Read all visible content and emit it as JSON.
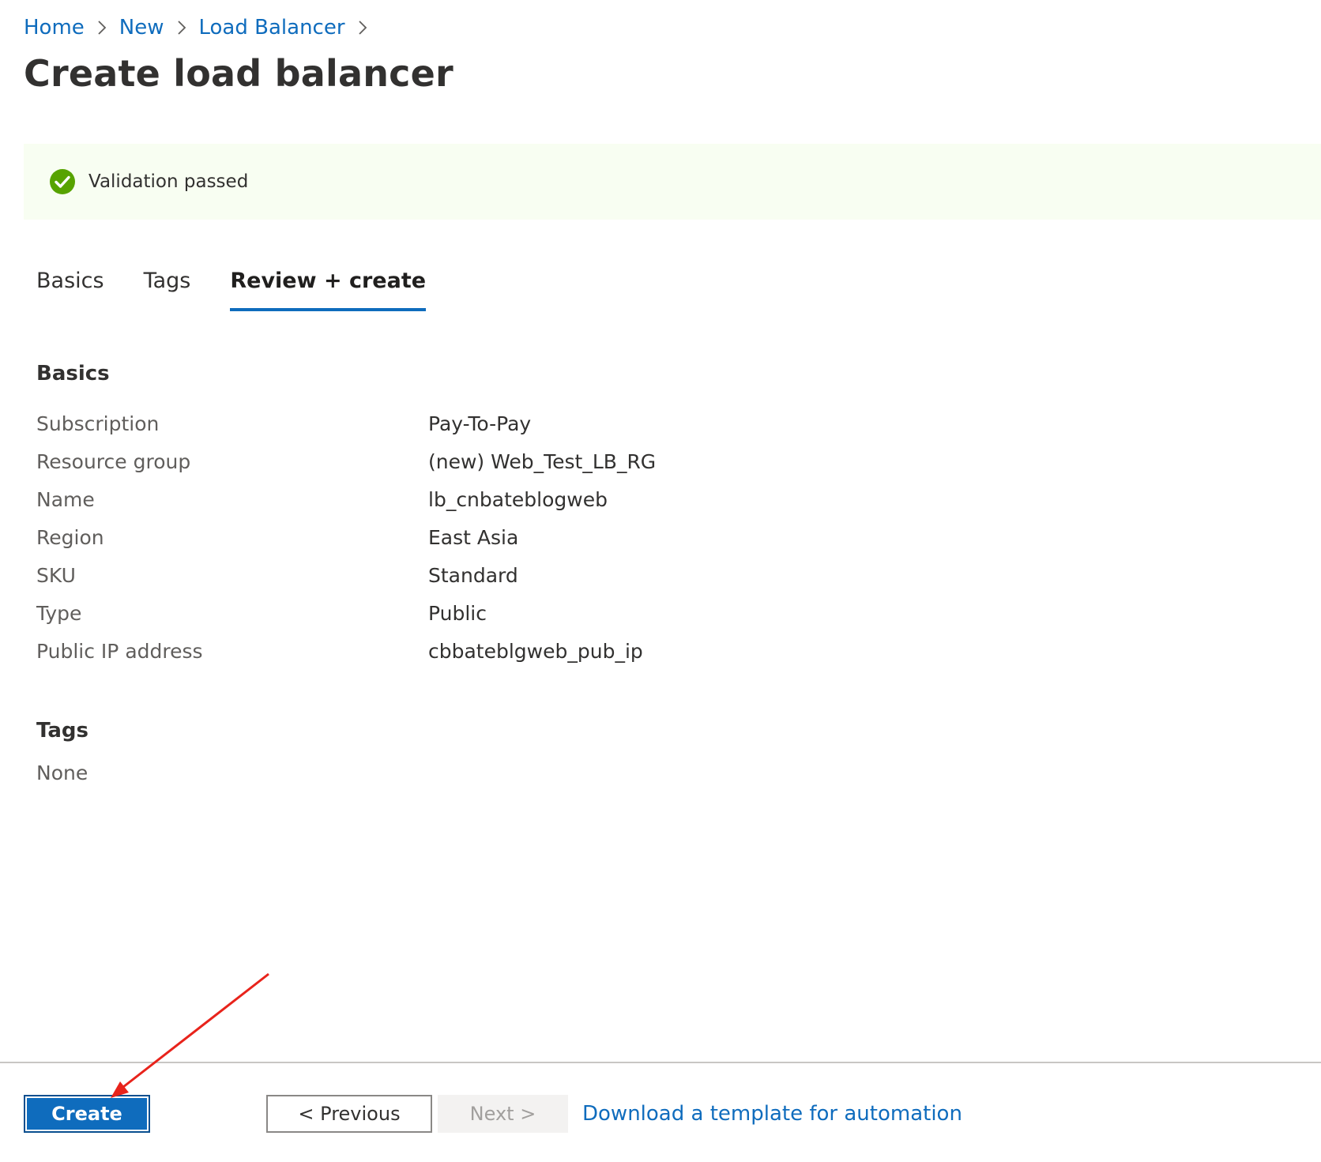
{
  "breadcrumb": {
    "items": [
      "Home",
      "New",
      "Load Balancer"
    ]
  },
  "page": {
    "title": "Create load balancer"
  },
  "banner": {
    "text": "Validation passed",
    "icon": "check-circle-icon",
    "color": "#57a300"
  },
  "tabs": [
    {
      "label": "Basics",
      "active": false
    },
    {
      "label": "Tags",
      "active": false
    },
    {
      "label": "Review + create",
      "active": true
    }
  ],
  "basics": {
    "heading": "Basics",
    "rows": [
      {
        "label": "Subscription",
        "value": "Pay-To-Pay"
      },
      {
        "label": "Resource group",
        "value": "(new) Web_Test_LB_RG"
      },
      {
        "label": "Name",
        "value": "lb_cnbateblogweb"
      },
      {
        "label": "Region",
        "value": "East Asia"
      },
      {
        "label": "SKU",
        "value": "Standard"
      },
      {
        "label": "Type",
        "value": "Public"
      },
      {
        "label": "Public IP address",
        "value": "cbbateblgweb_pub_ip"
      }
    ]
  },
  "tags": {
    "heading": "Tags",
    "value": "None"
  },
  "footer": {
    "create_label": "Create",
    "previous_label": "< Previous",
    "next_label": "Next >",
    "download_label": "Download a template for automation"
  },
  "colors": {
    "accent": "#0f6cbd",
    "annotation_arrow": "#e8231b"
  }
}
